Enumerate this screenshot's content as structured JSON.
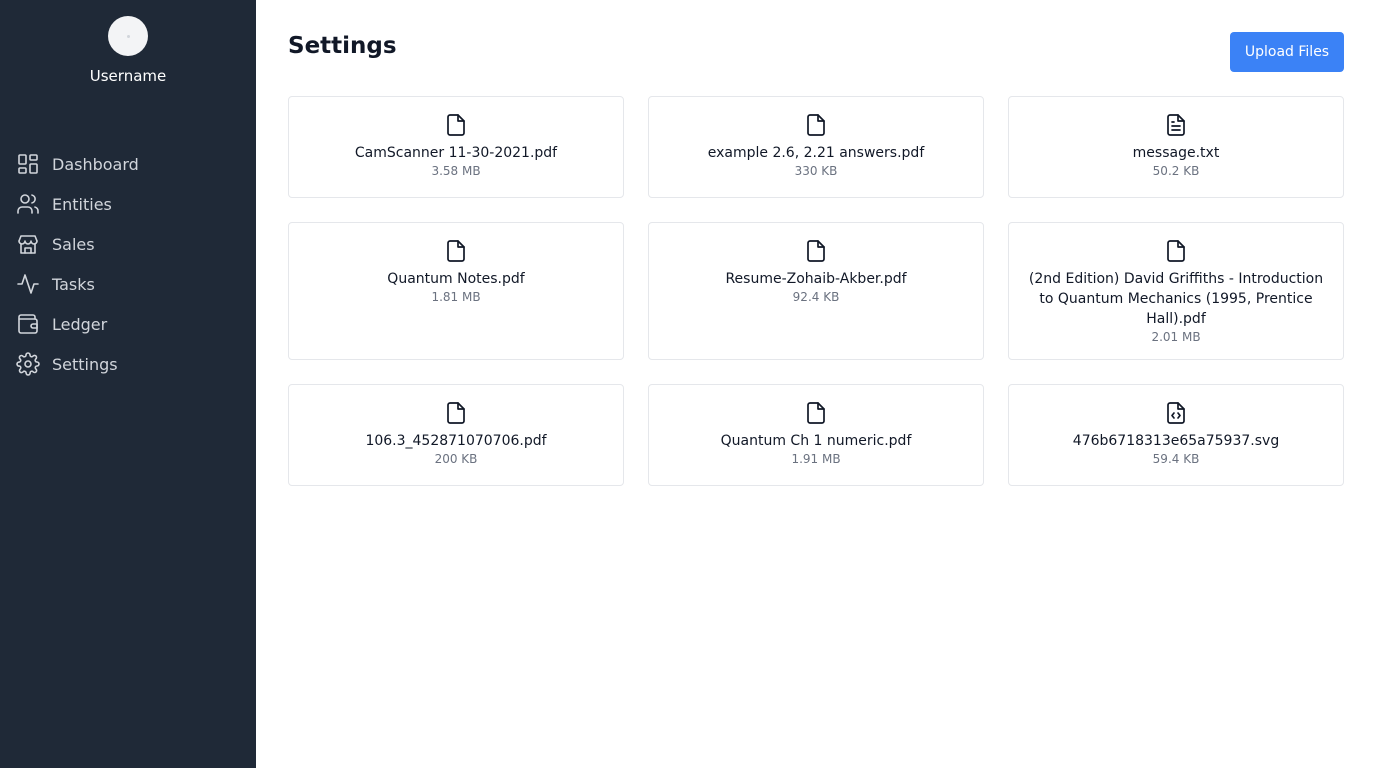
{
  "sidebar": {
    "username": "Username",
    "items": [
      {
        "label": "Dashboard",
        "icon": "dashboard-icon"
      },
      {
        "label": "Entities",
        "icon": "users-icon"
      },
      {
        "label": "Sales",
        "icon": "store-icon"
      },
      {
        "label": "Tasks",
        "icon": "activity-icon"
      },
      {
        "label": "Ledger",
        "icon": "wallet-icon"
      },
      {
        "label": "Settings",
        "icon": "gear-icon"
      }
    ]
  },
  "header": {
    "title": "Settings",
    "upload_label": "Upload Files"
  },
  "colors": {
    "sidebar_bg": "#1f2937",
    "accent": "#3b82f6"
  },
  "files": [
    {
      "name": "CamScanner 11-30-2021.pdf",
      "size": "3.58 MB",
      "icon": "file-icon"
    },
    {
      "name": "example 2.6, 2.21 answers.pdf",
      "size": "330 KB",
      "icon": "file-icon"
    },
    {
      "name": "message.txt",
      "size": "50.2 KB",
      "icon": "file-text-icon"
    },
    {
      "name": "Quantum Notes.pdf",
      "size": "1.81 MB",
      "icon": "file-icon"
    },
    {
      "name": "Resume-Zohaib-Akber.pdf",
      "size": "92.4 KB",
      "icon": "file-icon"
    },
    {
      "name": "(2nd Edition) David Griffiths - Introduction to Quantum Mechanics (1995, Prentice Hall).pdf",
      "size": "2.01 MB",
      "icon": "file-icon"
    },
    {
      "name": "106.3_452871070706.pdf",
      "size": "200 KB",
      "icon": "file-icon"
    },
    {
      "name": "Quantum Ch 1 numeric.pdf",
      "size": "1.91 MB",
      "icon": "file-icon"
    },
    {
      "name": "476b6718313e65a75937.svg",
      "size": "59.4 KB",
      "icon": "file-code-icon"
    }
  ]
}
